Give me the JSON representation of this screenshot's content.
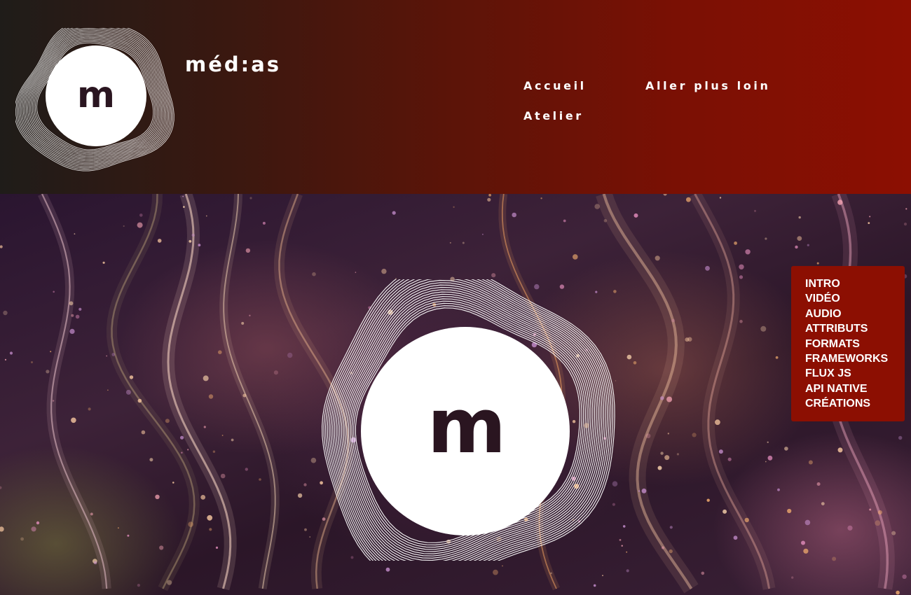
{
  "header": {
    "site_title": "méd:as",
    "logo_letter": "m",
    "nav": [
      {
        "label": "Accueil"
      },
      {
        "label": "Aller plus loin"
      },
      {
        "label": "Atelier"
      }
    ]
  },
  "hero": {
    "logo_letter": "m"
  },
  "side_menu": {
    "items": [
      {
        "label": "INTRO"
      },
      {
        "label": "VIDÉO"
      },
      {
        "label": "AUDIO"
      },
      {
        "label": "ATTRIBUTS"
      },
      {
        "label": "FORMATS"
      },
      {
        "label": "FRAMEWORKS"
      },
      {
        "label": "FLUX JS"
      },
      {
        "label": "API NATIVE"
      },
      {
        "label": "CRÉATIONS"
      }
    ]
  },
  "colors": {
    "brand_red": "#8c0f02",
    "header_dark": "#1f1c19",
    "logo_disc": "#ffffff",
    "logo_letter": "#2a1520"
  },
  "icons": {
    "header_logo": "medias-ring-logo",
    "hero_logo": "medias-ring-logo"
  }
}
